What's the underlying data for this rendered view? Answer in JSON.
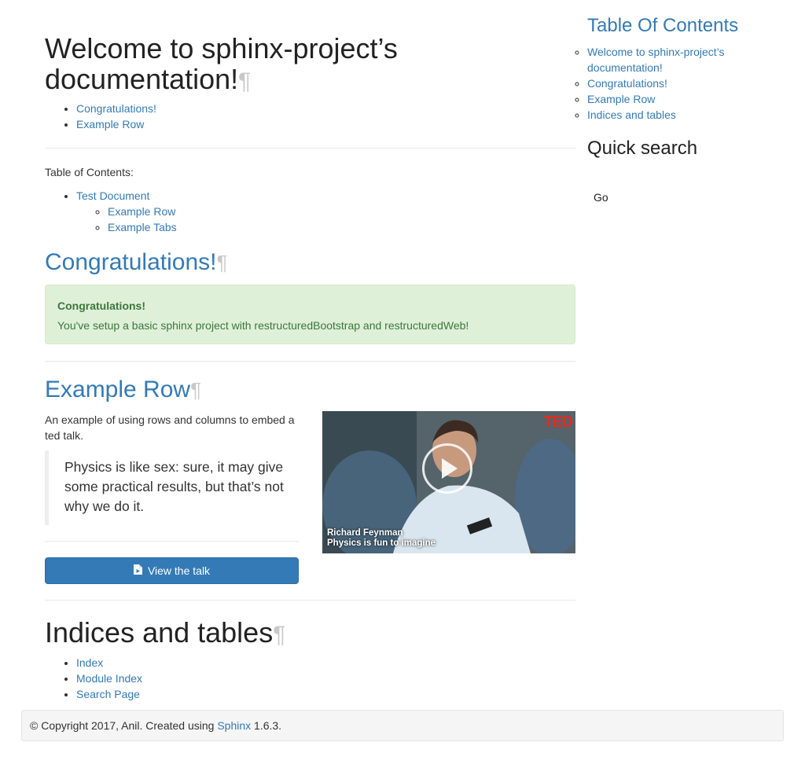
{
  "main": {
    "title": "Welcome to sphinx-project’s documentation!",
    "pilcrow": "¶",
    "top_links": [
      "Congratulations!",
      "Example Row"
    ],
    "toc_label": "Table of Contents:",
    "toc": {
      "item": "Test Document",
      "sub_items": [
        "Example Row",
        "Example Tabs"
      ]
    },
    "congrats": {
      "heading": "Congratulations!",
      "alert_title": "Congratulations!",
      "alert_body": "You've setup a basic sphinx project with restructuredBootstrap and restructuredWeb!"
    },
    "example_row": {
      "heading": "Example Row",
      "intro": "An example of using rows and columns to embed a ted talk.",
      "quote": "Physics is like sex: sure, it may give some practical results, but that’s not why we do it.",
      "button_label": "View the talk",
      "video": {
        "brand": "TED",
        "speaker": "Richard Feynman",
        "talk_title": "Physics is fun to imagine"
      }
    },
    "indices": {
      "heading": "Indices and tables",
      "links": [
        "Index",
        "Module Index",
        "Search Page"
      ]
    }
  },
  "sidebar": {
    "toc_heading": "Table Of Contents",
    "toc_links": [
      "Welcome to sphinx-project’s documentation!",
      "Congratulations!",
      "Example Row",
      "Indices and tables"
    ],
    "search_heading": "Quick search",
    "search_button": "Go"
  },
  "footer": {
    "text_before": "© Copyright 2017, Anil. Created using ",
    "link": "Sphinx",
    "text_after": " 1.6.3."
  },
  "colors": {
    "link": "#337ab7",
    "alert_bg": "#dff0d8",
    "alert_text": "#3c763d",
    "button": "#337ab7",
    "ted_red": "#e62b1e"
  },
  "icons": {
    "play": "play-icon",
    "file": "file-video-icon"
  }
}
